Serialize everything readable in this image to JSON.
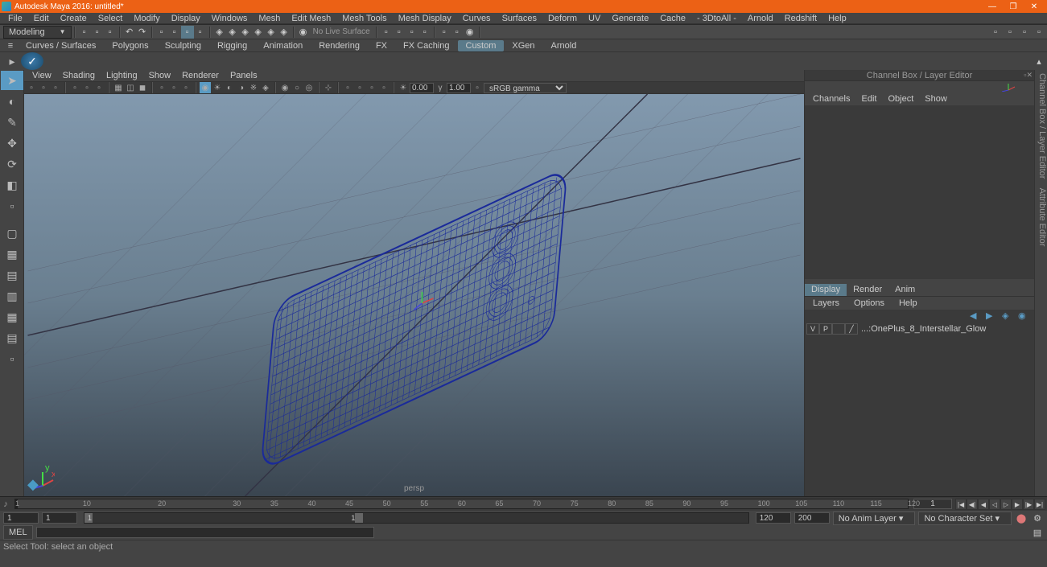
{
  "title": "Autodesk Maya 2016: untitled*",
  "menus": [
    "File",
    "Edit",
    "Create",
    "Select",
    "Modify",
    "Display",
    "Windows",
    "Mesh",
    "Edit Mesh",
    "Mesh Tools",
    "Mesh Display",
    "Curves",
    "Surfaces",
    "Deform",
    "UV",
    "Generate",
    "Cache",
    "- 3DtoAll -",
    "Arnold",
    "Redshift",
    "Help"
  ],
  "workspace": "Modeling",
  "status_text": "No Live Surface",
  "shelf_tabs": [
    "Curves / Surfaces",
    "Polygons",
    "Sculpting",
    "Rigging",
    "Animation",
    "Rendering",
    "FX",
    "FX Caching",
    "Custom",
    "XGen",
    "Arnold"
  ],
  "shelf_active": "Custom",
  "vp_menus": [
    "View",
    "Shading",
    "Lighting",
    "Show",
    "Renderer",
    "Panels"
  ],
  "vp_exposure": "0.00",
  "vp_gamma": "1.00",
  "vp_color": "sRGB gamma",
  "persp": "persp",
  "right_panel_title": "Channel Box / Layer Editor",
  "ch_menus": [
    "Channels",
    "Edit",
    "Object",
    "Show"
  ],
  "layer_tabs": [
    "Display",
    "Render",
    "Anim"
  ],
  "layer_tab_active": "Display",
  "layer_menus": [
    "Layers",
    "Options",
    "Help"
  ],
  "layer_row": {
    "v": "V",
    "p": "P",
    "name": "...:OnePlus_8_Interstellar_Glow"
  },
  "timeline": {
    "start": 1,
    "end": 120,
    "marks": [
      1,
      10,
      20,
      30,
      35,
      40,
      45,
      50,
      55,
      60,
      65,
      70,
      75,
      80,
      85,
      90,
      95,
      100,
      105,
      110,
      115,
      120
    ],
    "current": 1
  },
  "range": {
    "start": "1",
    "inner_start": "1",
    "inner_end": "120",
    "end": "120",
    "out_end": "200"
  },
  "anim_layer": "No Anim Layer",
  "char_set": "No Character Set",
  "cmd_lang": "MEL",
  "helpline": "Select Tool: select an object",
  "side_labels": [
    "Channel Box / Layer Editor",
    "Attribute Editor"
  ]
}
